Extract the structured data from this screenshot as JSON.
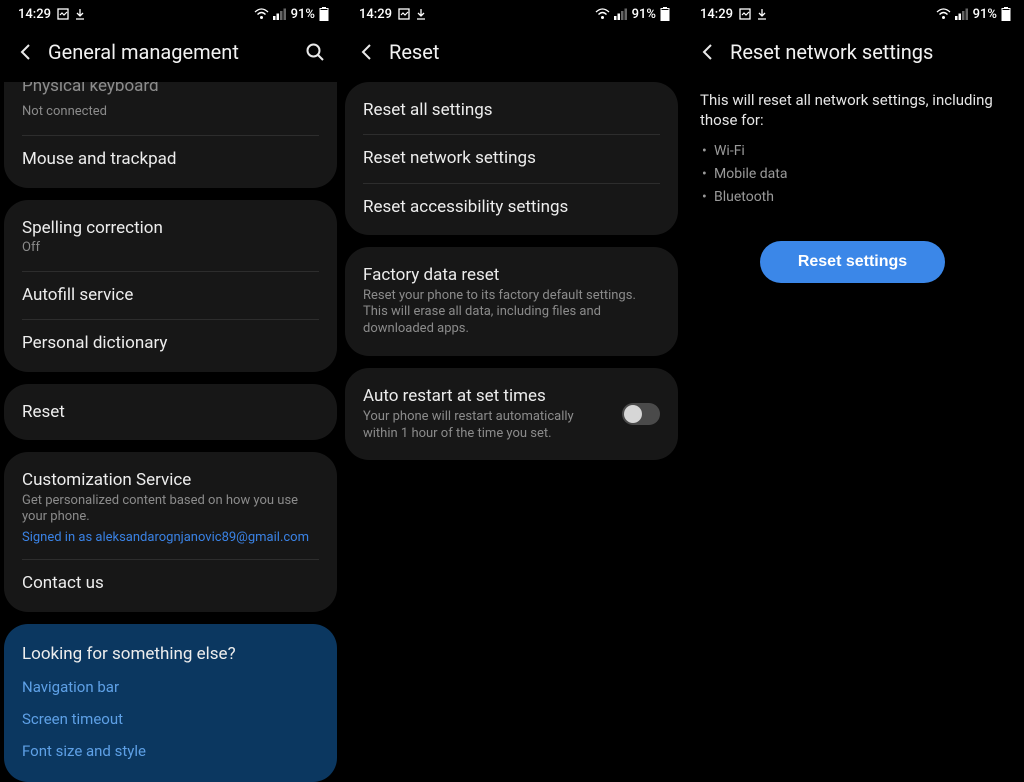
{
  "status": {
    "time": "14:29",
    "battery": "91%"
  },
  "p1": {
    "title": "General management",
    "card0": {
      "physical_keyboard": {
        "label": "Physical keyboard",
        "sub": "Not connected"
      },
      "mouse": "Mouse and trackpad"
    },
    "card1": {
      "spelling": {
        "label": "Spelling correction",
        "sub": "Off"
      },
      "autofill": "Autofill service",
      "dictionary": "Personal dictionary"
    },
    "card2": {
      "reset": "Reset"
    },
    "card3": {
      "cust": {
        "label": "Customization Service",
        "sub": "Get personalized content based on how you use your phone.",
        "link": "Signed in as aleksandarognjanovic89@gmail.com"
      },
      "contact": "Contact us"
    },
    "look": {
      "heading": "Looking for something else?",
      "q1": "Navigation bar",
      "q2": "Screen timeout",
      "q3": "Font size and style"
    }
  },
  "p2": {
    "title": "Reset",
    "card1": {
      "all": "Reset all settings",
      "network": "Reset network settings",
      "access": "Reset accessibility settings"
    },
    "card2": {
      "factory": {
        "label": "Factory data reset",
        "sub": "Reset your phone to its factory default settings. This will erase all data, including files and downloaded apps."
      }
    },
    "card3": {
      "auto": {
        "label": "Auto restart at set times",
        "sub": "Your phone will restart automatically within 1 hour of the time you set."
      }
    }
  },
  "p3": {
    "title": "Reset network settings",
    "desc": "This will reset all network settings, including those for:",
    "items": {
      "wifi": "Wi-Fi",
      "mobile": "Mobile data",
      "bt": "Bluetooth"
    },
    "button": "Reset settings"
  }
}
